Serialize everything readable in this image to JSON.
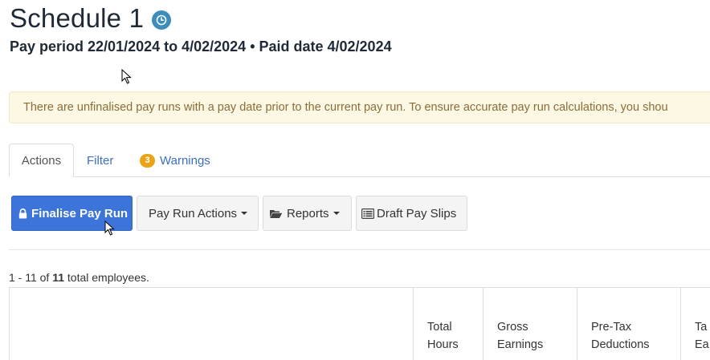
{
  "header": {
    "title": "Schedule 1",
    "subtitle": "Pay period 22/01/2024 to 4/02/2024 • Paid date 4/02/2024"
  },
  "alert": {
    "text": "There are unfinalised pay runs with a pay date prior to the current pay run. To ensure accurate pay run calculations, you shou"
  },
  "tabs": [
    {
      "label": "Actions"
    },
    {
      "label": "Filter"
    },
    {
      "label": "Warnings",
      "badge": "3"
    }
  ],
  "toolbar": {
    "finalise_label": "Finalise Pay Run",
    "pay_run_actions_label": "Pay Run Actions",
    "reports_label": "Reports",
    "draft_pay_slips_label": "Draft Pay Slips"
  },
  "summary": {
    "range": "1 - 11 of ",
    "total": "11",
    "suffix": " total employees."
  },
  "table": {
    "columns": [
      {
        "line1": "",
        "line2": ""
      },
      {
        "line1": "Total",
        "line2": "Hours"
      },
      {
        "line1": "Gross",
        "line2": "Earnings"
      },
      {
        "line1": "Pre-Tax",
        "line2": "Deductions"
      },
      {
        "line1": "Ta",
        "line2": "Ea"
      }
    ]
  },
  "colors": {
    "primary": "#3d74d9",
    "warning_badge": "#e8a317",
    "alert_bg": "#fcf8e3",
    "alert_text": "#8a6d3b",
    "link": "#3a6fc4"
  },
  "icons": {
    "title_badge": "clock-icon",
    "finalise": "lock-icon",
    "reports": "folder-open-icon",
    "draft_pay_slips": "list-icon"
  }
}
